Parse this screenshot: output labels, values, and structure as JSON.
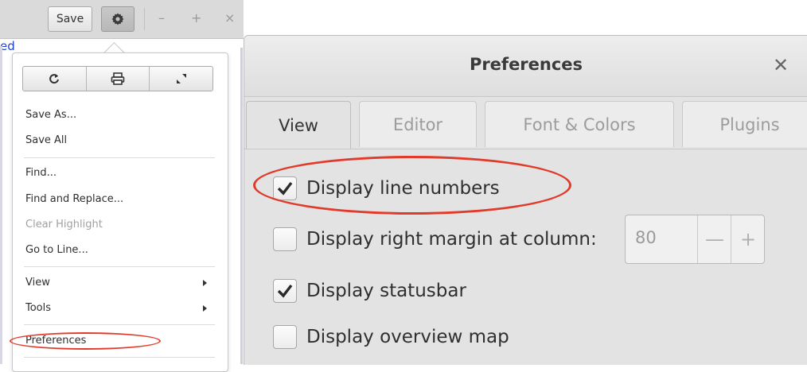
{
  "header": {
    "save_label": "Save",
    "gear_icon": "gear-icon",
    "minimize_glyph": "–",
    "maximize_glyph": "+",
    "close_glyph": "×"
  },
  "editor": {
    "visible_text": "ed"
  },
  "menu": {
    "toolbar_icons": [
      "refresh-icon",
      "print-icon",
      "fullscreen-icon"
    ],
    "items": [
      {
        "label": "Save As..."
      },
      {
        "label": "Save All"
      },
      {
        "label": "Find..."
      },
      {
        "label": "Find and Replace..."
      },
      {
        "label": "Clear Highlight",
        "disabled": true
      },
      {
        "label": "Go to Line..."
      },
      {
        "label": "View",
        "submenu": true
      },
      {
        "label": "Tools",
        "submenu": true
      },
      {
        "label": "Preferences"
      }
    ]
  },
  "preferences": {
    "title": "Preferences",
    "close_glyph": "✕",
    "tabs": [
      {
        "label": "View",
        "active": true
      },
      {
        "label": "Editor"
      },
      {
        "label": "Font & Colors"
      },
      {
        "label": "Plugins"
      }
    ],
    "options": [
      {
        "label": "Display line numbers",
        "checked": true
      },
      {
        "label": "Display right margin at column:",
        "checked": false
      },
      {
        "label": "Display statusbar",
        "checked": true
      },
      {
        "label": "Display overview map",
        "checked": false
      }
    ],
    "right_margin": {
      "value": "80",
      "minus_glyph": "—",
      "plus_glyph": "+"
    }
  },
  "colors": {
    "annotation_red": "#e23a2a",
    "link_blue": "#1d3fd8"
  }
}
